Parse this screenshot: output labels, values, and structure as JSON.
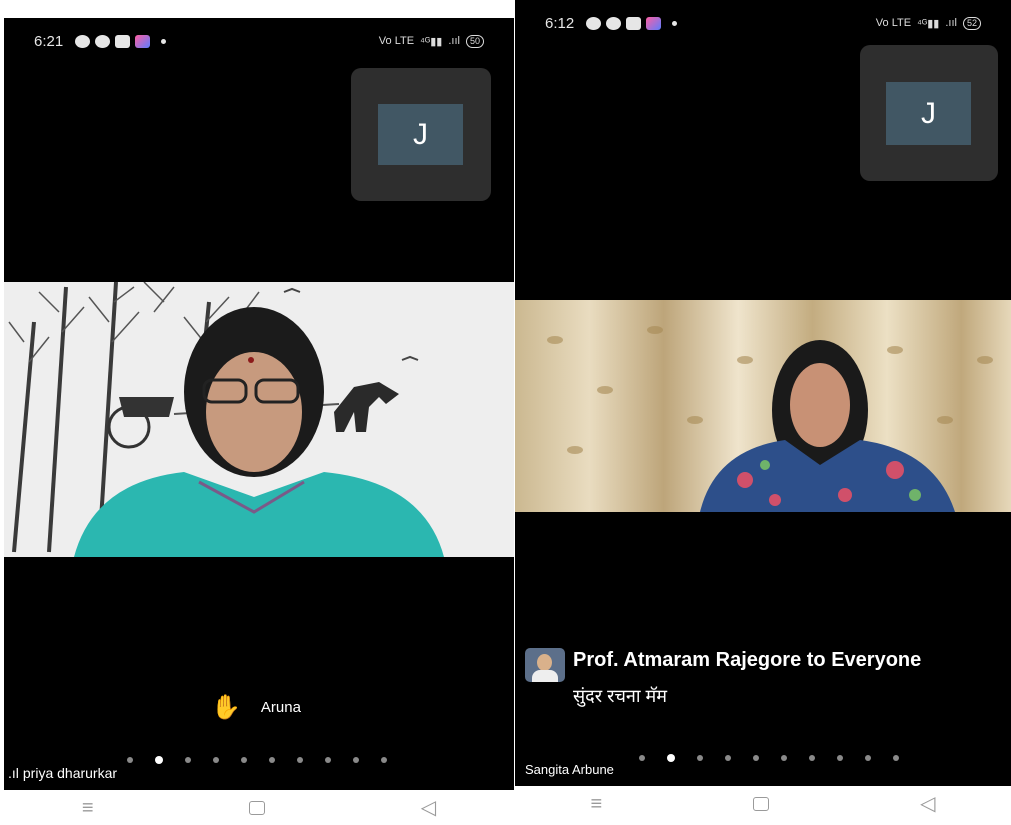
{
  "left_phone": {
    "status_time": "6:21",
    "battery": "50",
    "self_avatar_letter": "J",
    "raised_hand_name": "Aruna",
    "speaker_name": "priya dharurkar",
    "page_count": 10,
    "active_page": 1
  },
  "right_phone": {
    "status_time": "6:12",
    "battery": "52",
    "self_avatar_letter": "J",
    "chat": {
      "sender": "Prof. Atmaram Rajegore to Everyone",
      "message": "सुंदर रचना मॅम"
    },
    "speaker_name": "Sangita Arbune",
    "page_count": 10,
    "active_page": 1
  },
  "icons": {
    "signal": "signal-bars-icon",
    "hand": "raised-hand-icon",
    "nav_menu": "menu-icon",
    "nav_home": "home-square-icon",
    "nav_back": "back-triangle-icon"
  },
  "colors": {
    "background": "#000000",
    "avatar_tile": "#415764",
    "hand": "#f5b400"
  }
}
